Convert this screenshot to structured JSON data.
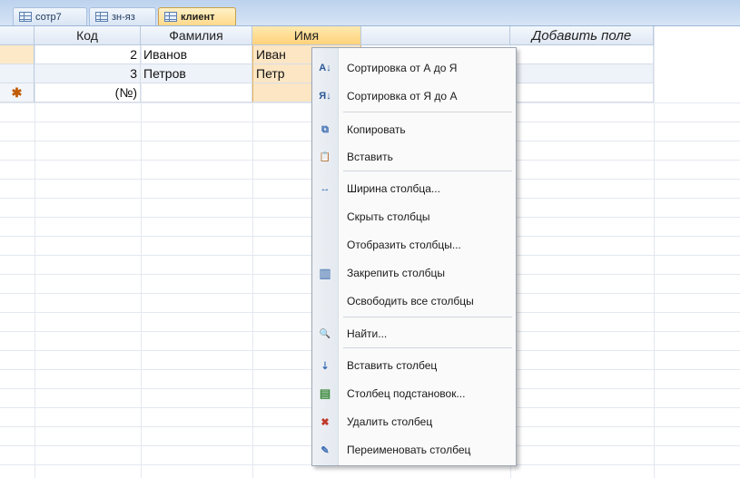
{
  "tabs": [
    {
      "label": "сотр7",
      "active": false
    },
    {
      "label": "зн-яз",
      "active": false
    },
    {
      "label": "клиент",
      "active": true
    }
  ],
  "table": {
    "columns": [
      "Код",
      "Фамилия",
      "Имя",
      "Добавить поле"
    ],
    "rows": [
      {
        "code": "2",
        "surname": "Иванов",
        "name": "Иван"
      },
      {
        "code": "3",
        "surname": "Петров",
        "name": "Петр"
      }
    ],
    "new_row": {
      "marker": "✱",
      "code": "(№)"
    }
  },
  "context_menu": {
    "items": [
      {
        "label": "Сортировка от А до Я",
        "icon": "sort-az-icon",
        "glyph": "A↓"
      },
      {
        "label": "Сортировка от Я до А",
        "icon": "sort-za-icon",
        "glyph": "Я↓"
      },
      {
        "label": "Копировать",
        "icon": "copy-icon",
        "glyph": "⧉"
      },
      {
        "label": "Вставить",
        "icon": "paste-icon",
        "glyph": "📋"
      },
      {
        "label": "Ширина столбца...",
        "icon": "column-width-icon",
        "glyph": "↔"
      },
      {
        "label": "Скрыть столбцы",
        "icon": "",
        "glyph": ""
      },
      {
        "label": "Отобразить столбцы...",
        "icon": "",
        "glyph": ""
      },
      {
        "label": "Закрепить столбцы",
        "icon": "freeze-columns-icon",
        "glyph": "▥"
      },
      {
        "label": "Освободить все столбцы",
        "icon": "",
        "glyph": ""
      },
      {
        "label": "Найти...",
        "icon": "find-binoculars-icon",
        "glyph": "🔍"
      },
      {
        "label": "Вставить столбец",
        "icon": "insert-column-icon",
        "glyph": "⇣"
      },
      {
        "label": "Столбец подстановок...",
        "icon": "lookup-column-icon",
        "glyph": "▤"
      },
      {
        "label": "Удалить столбец",
        "icon": "delete-column-icon",
        "glyph": "✖"
      },
      {
        "label": "Переименовать столбец",
        "icon": "rename-column-icon",
        "glyph": "✎"
      }
    ]
  },
  "colors": {
    "tab_active": "#ffd98a",
    "selected_column": "#fce6c4",
    "menu_background": "#fafafa"
  }
}
